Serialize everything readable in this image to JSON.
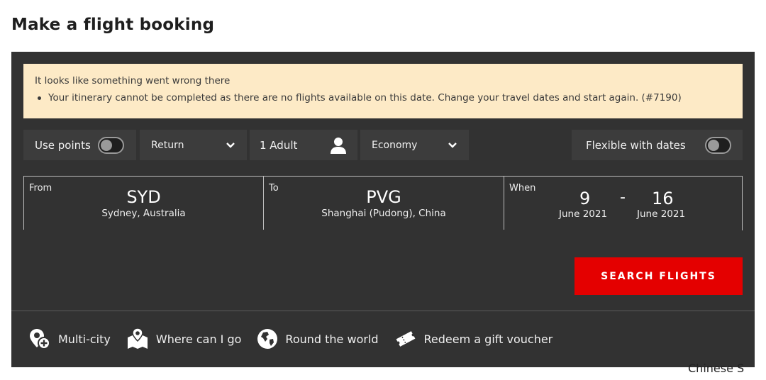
{
  "page": {
    "title": "Make a flight booking"
  },
  "alert": {
    "title": "It looks like something went wrong there",
    "items": [
      "Your itinerary cannot be completed as there are no flights available on this date. Change your travel dates and start again. (#7190)"
    ]
  },
  "options": {
    "use_points_label": "Use points",
    "trip_type": "Return",
    "passengers": "1 Adult",
    "cabin": "Economy",
    "flexible_label": "Flexible with dates"
  },
  "route": {
    "from": {
      "label": "From",
      "code": "SYD",
      "city": "Sydney, Australia"
    },
    "to": {
      "label": "To",
      "code": "PVG",
      "city": "Shanghai (Pudong), China"
    },
    "when": {
      "label": "When",
      "depart_day": "9",
      "depart_month": "June 2021",
      "separator": "-",
      "return_day": "16",
      "return_month": "June 2021"
    }
  },
  "search_button": "SEARCH FLIGHTS",
  "links": {
    "multi_city": "Multi-city",
    "where_can_i_go": "Where can I go",
    "round_the_world": "Round the world",
    "gift_voucher": "Redeem a gift voucher"
  },
  "clipped_text": "Chinese S",
  "icons": {
    "toggle": "toggle-off-icon",
    "chevron": "chevron-down-icon",
    "person": "person-icon",
    "multi_city": "location-pin-plus-icon",
    "where": "map-pin-icon",
    "world": "globe-icon",
    "voucher": "ticket-icon"
  },
  "colors": {
    "panel_bg": "#323232",
    "option_bg": "#3c3c3c",
    "alert_bg": "#fdeac6",
    "primary_button": "#e40000"
  }
}
